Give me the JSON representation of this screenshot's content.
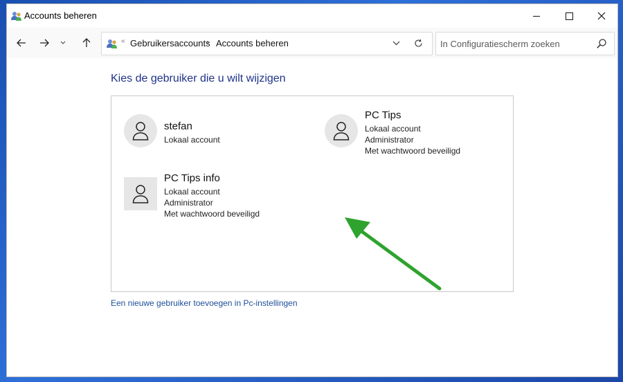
{
  "window": {
    "title": "Accounts beheren",
    "app_icon": "users-icon"
  },
  "navigation": {
    "back_icon": "arrow-left-icon",
    "forward_icon": "arrow-right-icon",
    "recent_icon": "chevron-down-icon",
    "up_icon": "arrow-up-icon"
  },
  "address": {
    "icon": "users-icon",
    "breadcrumb": [
      "Gebruikersaccounts",
      "Accounts beheren"
    ]
  },
  "search": {
    "placeholder": "In Configuratiescherm zoeken"
  },
  "main": {
    "heading": "Kies de gebruiker die u wilt wijzigen",
    "accounts": [
      {
        "name": "stefan",
        "lines": [
          "Lokaal account"
        ],
        "avatar": "user-icon"
      },
      {
        "name": "PC Tips",
        "lines": [
          "Lokaal account",
          "Administrator",
          "Met wachtwoord beveiligd"
        ],
        "avatar": "user-icon"
      },
      {
        "name": "PC Tips info",
        "lines": [
          "Lokaal account",
          "Administrator",
          "Met wachtwoord beveiligd"
        ],
        "avatar": "user-icon"
      }
    ],
    "add_user_link": "Een nieuwe gebruiker toevoegen in Pc-instellingen"
  },
  "colors": {
    "heading": "#1e3287",
    "link": "#1e4e9a",
    "annotation_arrow": "#2ea32e"
  }
}
